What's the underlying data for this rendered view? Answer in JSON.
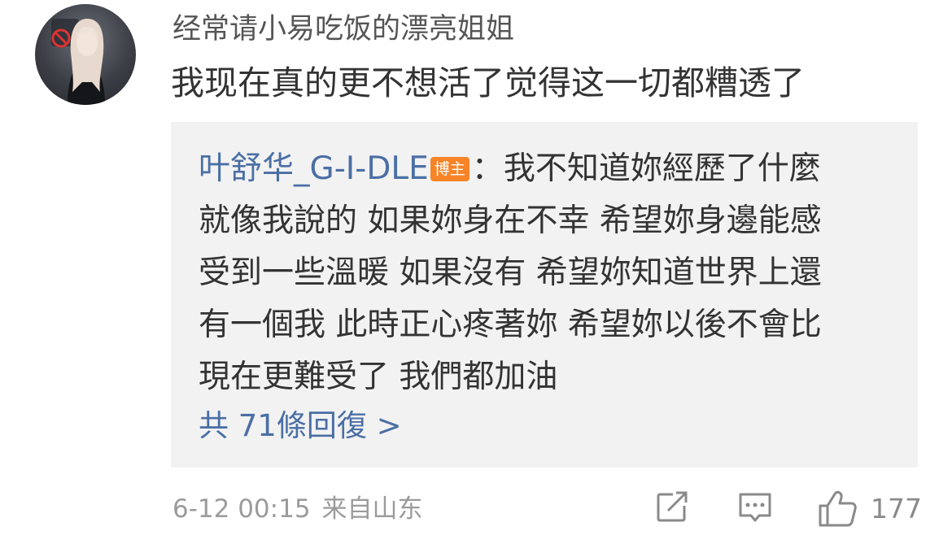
{
  "comment": {
    "username": "经常请小易吃饭的漂亮姐姐",
    "text": "我现在真的更不想活了觉得这一切都糟透了"
  },
  "reply": {
    "author": "叶舒华_G-I-DLE",
    "author_badge": "博主",
    "separator": "：",
    "lines": [
      "我不知道妳經歷了什麼",
      "就像我說的 如果妳身在不幸 希望妳身邊能感",
      "受到一些溫暖 如果沒有 希望妳知道世界上還",
      "有一個我 此時正心疼著妳 希望妳以後不會比",
      "現在更難受了 我們都加油"
    ],
    "reply_count_label": "共 71條回復 >"
  },
  "meta": {
    "timestamp": "6-12 00:15",
    "location": "来自山东"
  },
  "actions": {
    "forward_icon": "share-arrow-icon",
    "comment_icon": "comment-bubble-icon",
    "like_icon": "thumbs-up-icon",
    "like_count": "177"
  },
  "colors": {
    "link_blue": "#4a6fa5",
    "badge_orange": "#f78427",
    "reply_background": "#f2f2f2",
    "meta_gray": "#9b9b9b"
  }
}
